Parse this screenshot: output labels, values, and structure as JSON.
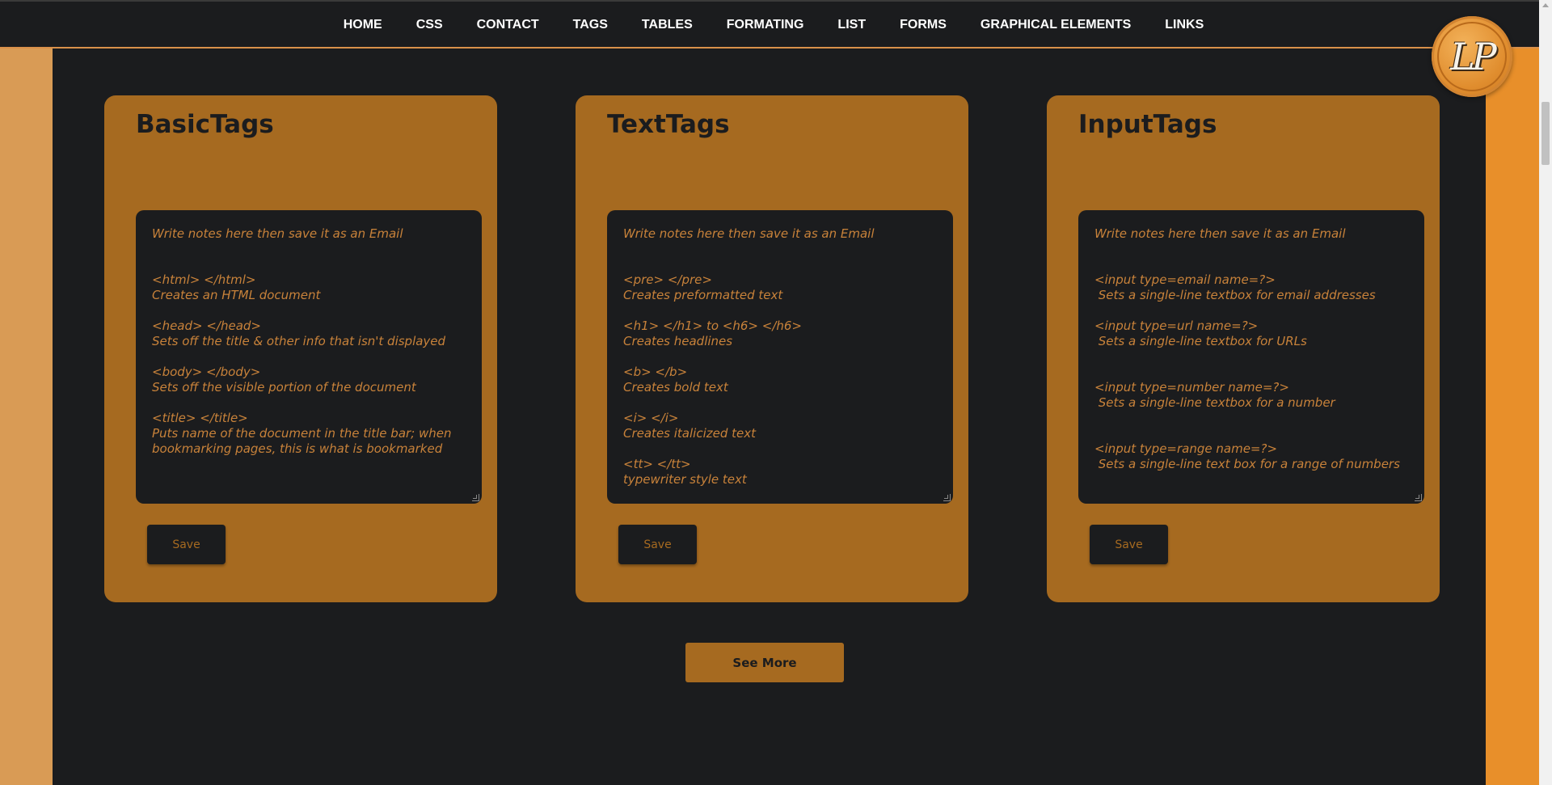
{
  "nav": {
    "items": [
      {
        "label": "HOME"
      },
      {
        "label": "CSS"
      },
      {
        "label": "CONTACT"
      },
      {
        "label": "TAGS"
      },
      {
        "label": "TABLES"
      },
      {
        "label": "FORMATING"
      },
      {
        "label": "LIST"
      },
      {
        "label": "FORMS"
      },
      {
        "label": "GRAPHICAL ELEMENTS"
      },
      {
        "label": "LINKS"
      }
    ]
  },
  "logo": {
    "text": "LP",
    "icon": "lp-monogram-logo"
  },
  "cards": [
    {
      "title": "BasicTags",
      "notes": "Write notes here then save it as an Email\n\n\n<html> </html>\nCreates an HTML document\n\n<head> </head>\nSets off the title & other info that isn't displayed\n\n<body> </body>\nSets off the visible portion of the document\n\n<title> </title>\nPuts name of the document in the title bar; when bookmarking pages, this is what is bookmarked",
      "save_label": "Save"
    },
    {
      "title": "TextTags",
      "notes": "Write notes here then save it as an Email\n\n\n<pre> </pre>\nCreates preformatted text\n\n<h1> </h1> to <h6> </h6>\nCreates headlines\n\n<b> </b>\nCreates bold text\n\n<i> </i>\nCreates italicized text\n\n<tt> </tt>\ntypewriter style text",
      "save_label": "Save"
    },
    {
      "title": "InputTags",
      "notes": "Write notes here then save it as an Email\n\n\n<input type=email name=?>\n Sets a single-line textbox for email addresses\n\n<input type=url name=?>\n Sets a single-line textbox for URLs\n\n\n<input type=number name=?>\n Sets a single-line textbox for a number\n\n\n<input type=range name=?>\n Sets a single-line text box for a range of numbers",
      "save_label": "Save"
    }
  ],
  "see_more_label": "See More",
  "colors": {
    "background": "#1b1c1e",
    "card": "#a66a20",
    "accent_text": "#c8823a",
    "left_band": "#d99b55",
    "right_band": "#e88f2a",
    "nav_text": "#ffffff"
  }
}
